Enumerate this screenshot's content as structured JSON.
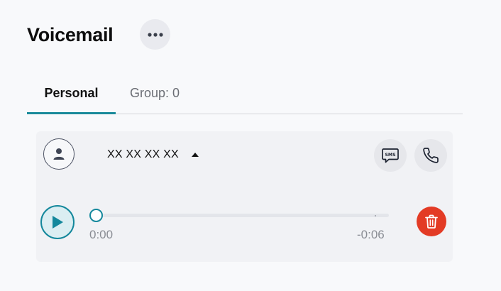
{
  "header": {
    "title": "Voicemail",
    "more_icon": "more-horizontal-icon"
  },
  "tabs": [
    {
      "label": "Personal",
      "active": true
    },
    {
      "label": "Group: 0",
      "active": false
    }
  ],
  "voicemail": {
    "avatar_icon": "user-icon",
    "caller": "XX XX XX XX",
    "caller_toggle_icon": "caret-up-icon",
    "actions": {
      "sms_icon": "sms-icon",
      "sms_icon_text": "SMS",
      "call_icon": "phone-icon",
      "delete_icon": "trash-icon"
    },
    "player": {
      "play_icon": "play-icon",
      "elapsed": "0:00",
      "remaining": "-0:06",
      "progress": 0
    }
  },
  "colors": {
    "accent": "#14889c",
    "danger": "#e33b25",
    "background": "#f8f9fb",
    "card": "#f1f2f5"
  }
}
